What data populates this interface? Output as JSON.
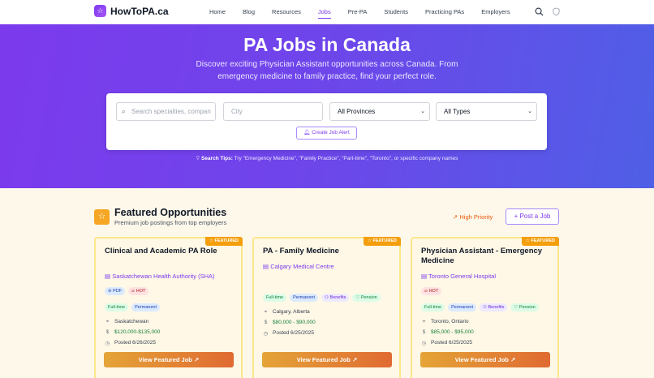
{
  "nav": {
    "logo_icon": "star-icon",
    "logo_text": "HowToPA.ca",
    "links": [
      "Home",
      "Blog",
      "Resources",
      "Jobs",
      "Pre-PA",
      "Students",
      "Practicing PAs",
      "Employers"
    ],
    "active": "Jobs"
  },
  "hero": {
    "title": "PA Jobs in Canada",
    "subtitle": "Discover exciting Physician Assistant opportunities across Canada. From emergency medicine to family practice, find your perfect role.",
    "search_placeholder": "Search specialties, compan",
    "city_placeholder": "City",
    "province_value": "All Provinces",
    "type_value": "All Types",
    "alert_label": "Create Job Alert",
    "tips_label": "Search Tips:",
    "tips_text": "Try \"Emergency Medicine\", \"Family Practice\", \"Part-time\", \"Toronto\", or specific company names"
  },
  "featured": {
    "title": "Featured Opportunities",
    "subtitle": "Premium job postings from top employers",
    "priority_label": "High Priority",
    "post_label": "Post a Job",
    "badge": "FEATURED",
    "view_label": "View Featured Job",
    "cards": [
      {
        "title": "Clinical and Academic PA Role",
        "company": "Saskatchewan Health Authority (SHA)",
        "tags": [
          "PDF",
          "HOT"
        ],
        "types": [
          "Full-time",
          "Permanent"
        ],
        "location": "Saskatchewan",
        "salary": "$120,000-$135,000",
        "posted": "Posted 6/26/2025"
      },
      {
        "title": "PA - Family Medicine",
        "company": "Calgary Medical Centre",
        "tags": [],
        "types": [
          "Full-time",
          "Permanent",
          "Benefits",
          "Pension"
        ],
        "location": "Calgary, Alberta",
        "salary": "$80,000 - $90,000",
        "posted": "Posted 6/25/2025"
      },
      {
        "title": "Physician Assistant - Emergency Medicine",
        "company": "Toronto General Hospital",
        "tags": [
          "HOT"
        ],
        "types": [
          "Full-time",
          "Permanent",
          "Benefits",
          "Pension"
        ],
        "location": "Toronto, Ontario",
        "salary": "$85,000 - $95,000",
        "posted": "Posted 6/25/2025"
      }
    ]
  }
}
